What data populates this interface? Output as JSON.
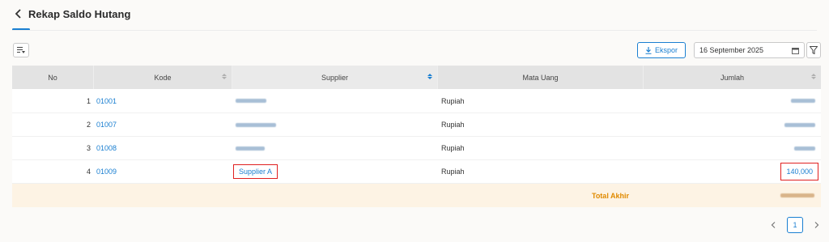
{
  "header": {
    "title": "Rekap Saldo Hutang"
  },
  "toolbar": {
    "export_label": "Ekspor",
    "date_value": "16 September 2025"
  },
  "table": {
    "columns": [
      "No",
      "Kode",
      "Supplier",
      "Mata Uang",
      "Jumlah"
    ],
    "rows": [
      {
        "no": "1",
        "kode": "01001",
        "supplier": "",
        "mata_uang": "Rupiah",
        "jumlah": ""
      },
      {
        "no": "2",
        "kode": "01007",
        "supplier": "",
        "mata_uang": "Rupiah",
        "jumlah": ""
      },
      {
        "no": "3",
        "kode": "01008",
        "supplier": "",
        "mata_uang": "Rupiah",
        "jumlah": ""
      },
      {
        "no": "4",
        "kode": "01009",
        "supplier": "Supplier A",
        "mata_uang": "Rupiah",
        "jumlah": "140,000"
      }
    ],
    "total_label": "Total Akhir"
  },
  "pagination": {
    "current_page": "1"
  },
  "colors": {
    "accent": "#1a7fd1",
    "highlight": "#e02020",
    "total_text": "#e08a00",
    "total_bg": "#fdf3e4"
  }
}
